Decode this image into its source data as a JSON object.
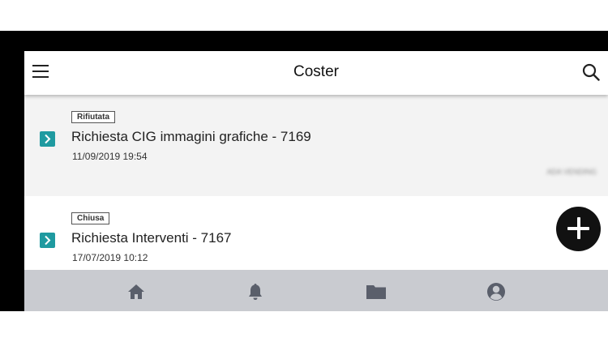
{
  "appbar": {
    "title": "Coster",
    "menu_icon": "hamburger-menu-icon",
    "search_icon": "search-icon"
  },
  "requests": [
    {
      "status": "Rifiutata",
      "title": "Richiesta CIG immagini grafiche - 7169",
      "date": "11/09/2019 19:54",
      "company": "ADA VENDING"
    },
    {
      "status": "Chiusa",
      "title": "Richiesta Interventi - 7167",
      "date": "17/07/2019 10:12"
    }
  ],
  "fab": {
    "icon": "plus-icon"
  },
  "bottom_nav": {
    "items": [
      {
        "icon": "home-icon"
      },
      {
        "icon": "bell-icon"
      },
      {
        "icon": "folder-icon"
      },
      {
        "icon": "user-account-icon"
      }
    ]
  },
  "colors": {
    "accent": "#1f9aa0",
    "bottom_nav_bg": "#c9cbd0",
    "fab_bg": "#111111",
    "nav_icon": "#5a5f6b"
  }
}
